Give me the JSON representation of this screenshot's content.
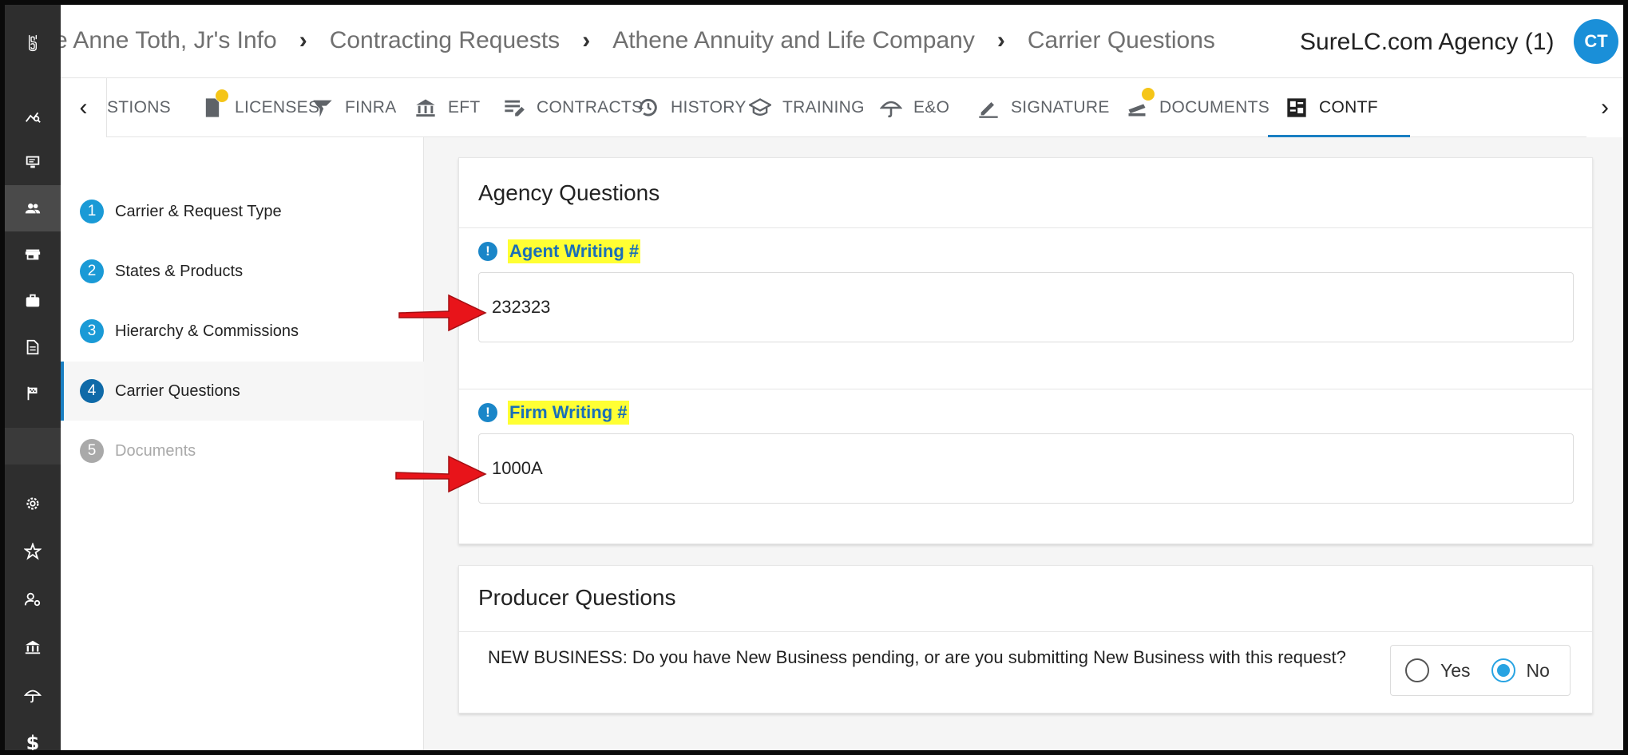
{
  "breadcrumbs": [
    "e Anne Toth, Jr's Info",
    "Contracting Requests",
    "Athene Annuity and Life Company",
    "Carrier Questions"
  ],
  "agency": "SureLC.com Agency (1)",
  "user_initials": "CT",
  "tabs": [
    {
      "label": "STIONS",
      "icon": "questions-icon"
    },
    {
      "label": "LICENSES",
      "icon": "license-icon",
      "badge": true
    },
    {
      "label": "FINRA",
      "icon": "finra-icon"
    },
    {
      "label": "EFT",
      "icon": "bank-icon"
    },
    {
      "label": "CONTRACTS",
      "icon": "contracts-icon"
    },
    {
      "label": "HISTORY",
      "icon": "history-icon"
    },
    {
      "label": "TRAINING",
      "icon": "training-icon"
    },
    {
      "label": "E&O",
      "icon": "umbrella-icon"
    },
    {
      "label": "SIGNATURE",
      "icon": "pen-icon"
    },
    {
      "label": "DOCUMENTS",
      "icon": "documents-icon",
      "badge": true
    },
    {
      "label": "CONTF",
      "icon": "dashboard-icon",
      "active": true
    }
  ],
  "steps": [
    {
      "num": "1",
      "label": "Carrier & Request Type"
    },
    {
      "num": "2",
      "label": "States & Products"
    },
    {
      "num": "3",
      "label": "Hierarchy & Commissions"
    },
    {
      "num": "4",
      "label": "Carrier Questions",
      "active": true
    },
    {
      "num": "5",
      "label": "Documents",
      "disabled": true
    }
  ],
  "agency_questions": {
    "title": "Agency Questions",
    "agent_writing_label": "Agent Writing #",
    "agent_writing_value": "232323",
    "firm_writing_label": "Firm Writing #",
    "firm_writing_value": "1000A"
  },
  "producer_questions": {
    "title": "Producer Questions",
    "new_business_question": "NEW BUSINESS: Do you have New Business pending, or are you submitting New Business with this request?",
    "yes_label": "Yes",
    "no_label": "No",
    "selected": "No"
  },
  "colors": {
    "accent": "#1a7fc2",
    "highlight": "#ffff33",
    "badge": "#f5c518",
    "arrow": "#e8141a"
  }
}
